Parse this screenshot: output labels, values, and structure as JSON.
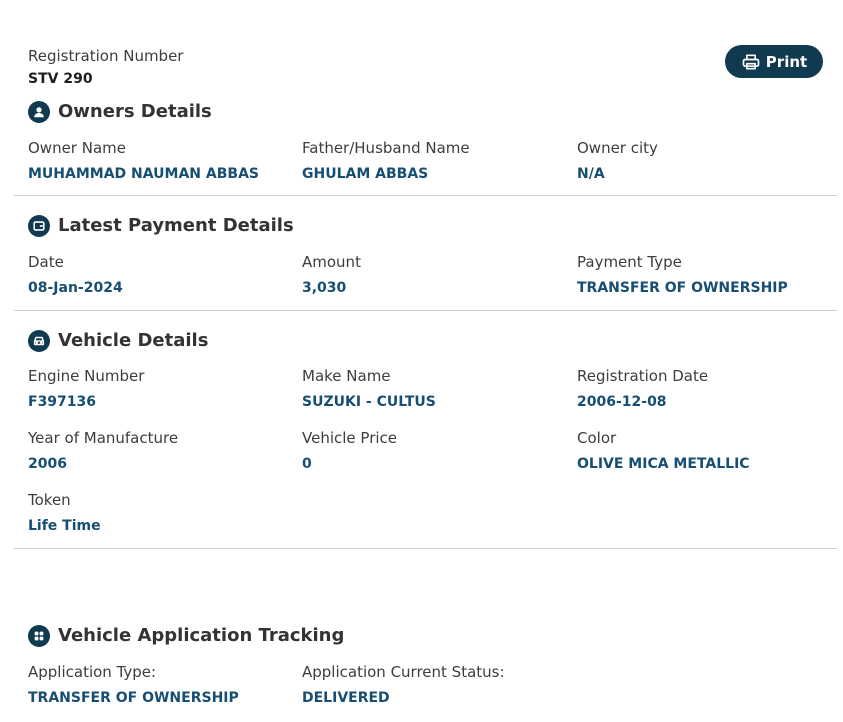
{
  "registration": {
    "label": "Registration Number",
    "value": "STV 290"
  },
  "print_button": {
    "label": "Print",
    "icon": "printer-icon"
  },
  "owners": {
    "title": "Owners Details",
    "icon": "user-icon",
    "fields": [
      {
        "label": "Owner Name",
        "value": "MUHAMMAD NAUMAN ABBAS"
      },
      {
        "label": "Father/Husband Name",
        "value": "GHULAM ABBAS"
      },
      {
        "label": "Owner city",
        "value": "N/A"
      }
    ]
  },
  "payment": {
    "title": "Latest Payment Details",
    "icon": "wallet-icon",
    "fields": [
      {
        "label": "Date",
        "value": "08-Jan-2024"
      },
      {
        "label": "Amount",
        "value": "3,030"
      },
      {
        "label": "Payment Type",
        "value": "TRANSFER OF OWNERSHIP"
      }
    ]
  },
  "vehicle": {
    "title": "Vehicle Details",
    "icon": "car-icon",
    "fields": [
      {
        "label": "Engine Number",
        "value": "F397136"
      },
      {
        "label": "Make Name",
        "value": "SUZUKI - CULTUS"
      },
      {
        "label": "Registration Date",
        "value": "2006-12-08"
      },
      {
        "label": "Year of Manufacture",
        "value": "2006"
      },
      {
        "label": "Vehicle Price",
        "value": "0"
      },
      {
        "label": "Color",
        "value": "OLIVE MICA METALLIC"
      },
      {
        "label": "Token",
        "value": "Life Time"
      }
    ]
  },
  "tracking": {
    "title": "Vehicle Application Tracking",
    "icon": "grid-icon",
    "fields": [
      {
        "label": "Application Type:",
        "value": "TRANSFER OF OWNERSHIP"
      },
      {
        "label": "Application Current Status:",
        "value": "DELIVERED"
      }
    ]
  },
  "colors": {
    "accent": "#0f3a4f",
    "value_text": "#174e73",
    "divider": "#cfcfcf"
  }
}
